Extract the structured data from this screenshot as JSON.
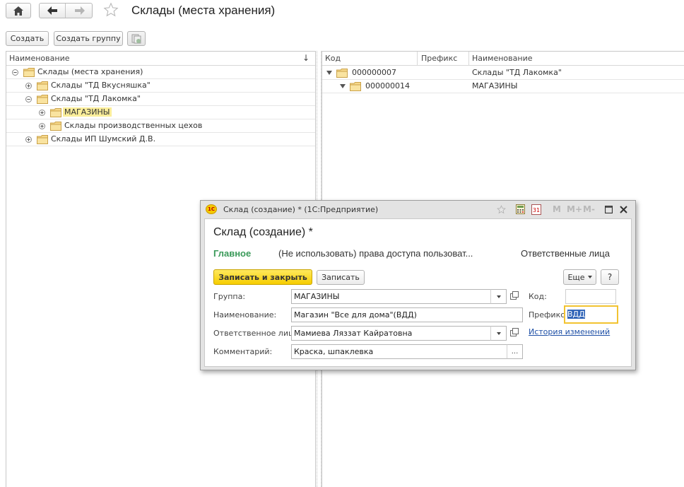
{
  "page": {
    "title": "Склады (места хранения)"
  },
  "toolbar": {
    "create_label": "Создать",
    "create_group_label": "Создать группу"
  },
  "tree": {
    "header": "Наименование",
    "sort_indicator": "↓",
    "rows": [
      {
        "label": "Склады (места хранения)"
      },
      {
        "label": "Склады \"ТД Вкусняшка\""
      },
      {
        "label": "Склады \"ТД Лакомка\""
      },
      {
        "label": "МАГАЗИНЫ"
      },
      {
        "label": "Склады производственных цехов"
      },
      {
        "label": "Склады ИП Шумский Д.В."
      }
    ]
  },
  "list": {
    "headers": {
      "code": "Код",
      "prefix": "Префикс",
      "name": "Наименование"
    },
    "rows": [
      {
        "code": "000000007",
        "prefix": "",
        "name": "Склады \"ТД Лакомка\""
      },
      {
        "code": "000000014",
        "prefix": "",
        "name": "МАГАЗИНЫ"
      }
    ]
  },
  "dialog": {
    "window_title": "Склад (создание) * (1С:Предприятие)",
    "logo_text": "1С",
    "memory_buttons": {
      "m": "M",
      "m_plus": "M+",
      "m_minus": "M-"
    },
    "calendar_day": "31",
    "form_title": "Склад (создание) *",
    "tabs": {
      "main": "Главное",
      "access": "(Не использовать) права доступа пользоват...",
      "responsible": "Ответственные лица"
    },
    "buttons": {
      "save_close": "Записать и закрыть",
      "save": "Записать",
      "more": "Еще",
      "help": "?"
    },
    "fields": {
      "group": {
        "label": "Группа:",
        "value": "МАГАЗИНЫ"
      },
      "name": {
        "label": "Наименование:",
        "value": "Магазин \"Все для дома\"(ВДД)"
      },
      "responsible": {
        "label": "Ответственное лицо:",
        "value": "Мамиева Ляззат Кайратовна"
      },
      "comment": {
        "label": "Комментарий:",
        "value": "Краска, шпаклевка",
        "button": "..."
      },
      "code": {
        "label": "Код:",
        "value": ""
      },
      "prefix": {
        "label": "Префикс:",
        "value": "ВДД"
      }
    },
    "history_link": "История изменений"
  },
  "colors": {
    "accent_green": "#3a9a59",
    "selection_yellow": "#fbee9a",
    "primary_button": "#f6cd00",
    "focus_border": "#f2c331",
    "link": "#1f50a6"
  }
}
